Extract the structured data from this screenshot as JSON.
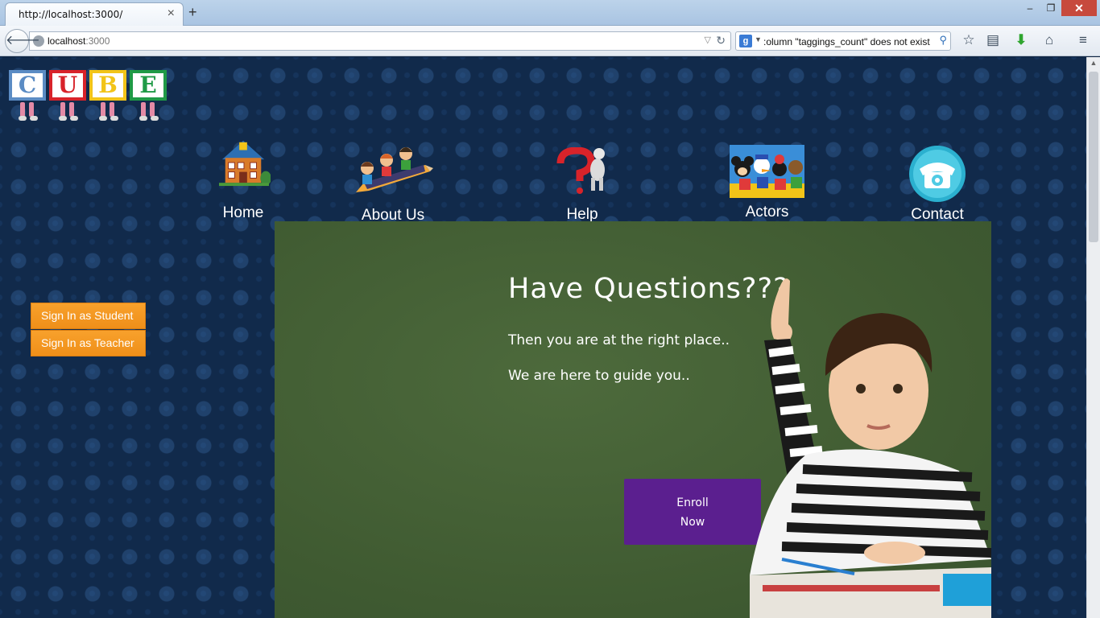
{
  "browser": {
    "tab_title": "http://localhost:3000/",
    "tab_close": "×",
    "new_tab": "+",
    "url_host": "localhost",
    "url_port": ":3000",
    "search_text": ":olumn \"taggings_count\" does not exist",
    "window_min": "–",
    "window_max": "❐",
    "window_close": "✕"
  },
  "logo": {
    "letters": [
      "C",
      "U",
      "B",
      "E"
    ],
    "colors": [
      "#5b8cc4",
      "#d8232a",
      "#f2c418",
      "#1f9a46"
    ]
  },
  "nav": {
    "items": [
      {
        "label": "Home",
        "icon": "house-icon"
      },
      {
        "label": "About Us",
        "icon": "kids-pencil-icon"
      },
      {
        "label": "Help",
        "icon": "question-figure-icon"
      },
      {
        "label": "Actors",
        "icon": "cartoon-characters-icon"
      },
      {
        "label": "Contact",
        "icon": "telephone-icon"
      }
    ]
  },
  "sidebar": {
    "student_button": "Sign In as Student",
    "teacher_button": "Sign In as Teacher"
  },
  "board": {
    "title": "Have Questions???",
    "line1": "Then you are at the right place..",
    "line2": "We are here to guide you..",
    "enroll_line1": "Enroll",
    "enroll_line2": "Now"
  },
  "colors": {
    "accent_orange": "#f7941d",
    "enroll_purple": "#5b1f8f",
    "board_green": "#46623a",
    "page_bg": "#112a4b"
  }
}
